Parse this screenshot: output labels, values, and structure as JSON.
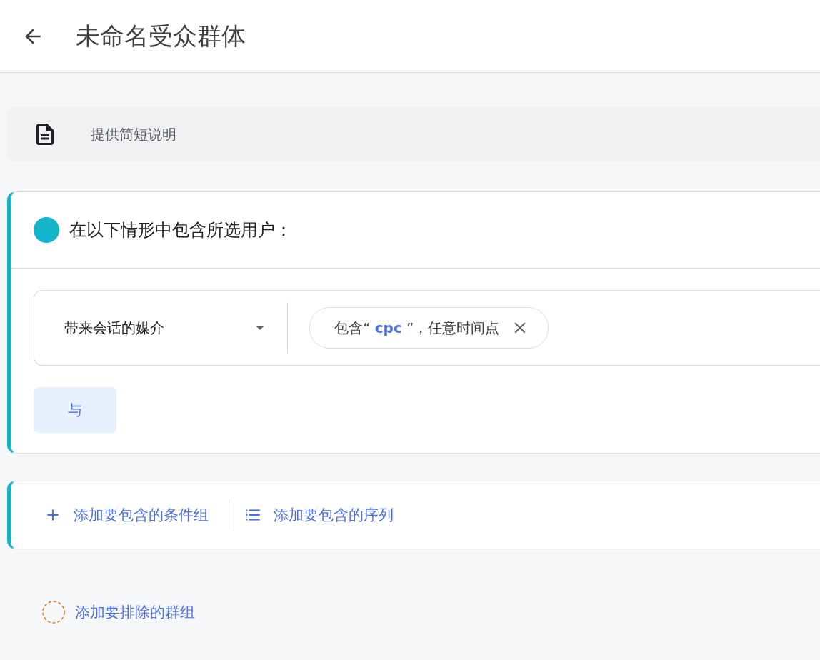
{
  "header": {
    "title": "未命名受众群体"
  },
  "description": {
    "placeholder": "提供简短说明"
  },
  "include_group": {
    "title": "在以下情形中包含所选用户：",
    "color": "#12b5cb",
    "conditions": [
      {
        "dimension": "带来会话的媒介",
        "filter": "包含“ **cpc** ”，任意时间点"
      }
    ],
    "and_button": "与"
  },
  "add_actions": [
    {
      "kind": "plus",
      "label": "添加要包含的条件组"
    },
    {
      "kind": "list",
      "label": "添加要包含的序列"
    }
  ],
  "exclude": {
    "label": "添加要排除的群组"
  }
}
